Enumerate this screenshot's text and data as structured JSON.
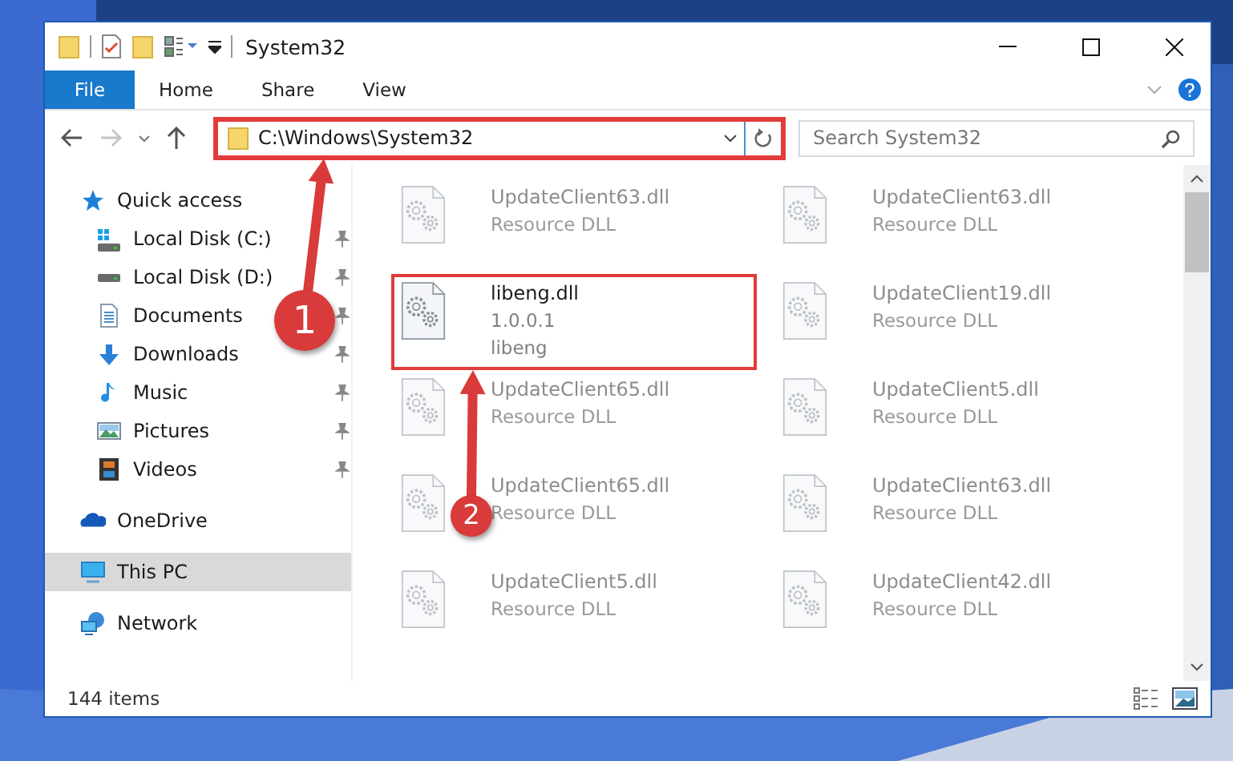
{
  "window": {
    "title": "System32"
  },
  "ribbon_tabs": [
    {
      "label": "File",
      "kind": "file"
    },
    {
      "label": "Home",
      "kind": "tab"
    },
    {
      "label": "Share",
      "kind": "tab"
    },
    {
      "label": "View",
      "kind": "tab"
    }
  ],
  "address_bar": {
    "path": "C:\\Windows\\System32",
    "highlighted": true
  },
  "search": {
    "placeholder": "Search System32"
  },
  "sidebar": {
    "items": [
      {
        "label": "Quick access",
        "kind": "star",
        "selected": false,
        "children": [
          {
            "label": "Local Disk (C:)",
            "kind": "system-drive",
            "pinned": true,
            "selected": false
          },
          {
            "label": "Local Disk (D:)",
            "kind": "drive",
            "pinned": true,
            "selected": false
          },
          {
            "label": "Documents",
            "kind": "documents",
            "pinned": true,
            "selected": false
          },
          {
            "label": "Downloads",
            "kind": "downloads",
            "pinned": true,
            "selected": false
          },
          {
            "label": "Music",
            "kind": "music",
            "pinned": true,
            "selected": false
          },
          {
            "label": "Pictures",
            "kind": "pictures",
            "pinned": true,
            "selected": false
          },
          {
            "label": "Videos",
            "kind": "videos",
            "pinned": true,
            "selected": false
          }
        ]
      },
      {
        "label": "OneDrive",
        "kind": "cloud",
        "selected": false
      },
      {
        "label": "This PC",
        "kind": "computer",
        "selected": true
      },
      {
        "label": "Network",
        "kind": "network",
        "selected": false
      }
    ]
  },
  "files": [
    {
      "name": "UpdateClient63.dll",
      "lines": [
        "Resource DLL"
      ],
      "dimmed": true,
      "highlighted": false
    },
    {
      "name": "UpdateClient63.dll",
      "lines": [
        "Resource DLL"
      ],
      "dimmed": true,
      "highlighted": false
    },
    {
      "name": "libeng.dll",
      "lines": [
        "1.0.0.1",
        "libeng"
      ],
      "dimmed": false,
      "highlighted": true
    },
    {
      "name": "UpdateClient19.dll",
      "lines": [
        "Resource DLL"
      ],
      "dimmed": true,
      "highlighted": false
    },
    {
      "name": "UpdateClient65.dll",
      "lines": [
        "Resource DLL"
      ],
      "dimmed": true,
      "highlighted": false
    },
    {
      "name": "UpdateClient5.dll",
      "lines": [
        "Resource DLL"
      ],
      "dimmed": true,
      "highlighted": false
    },
    {
      "name": "UpdateClient65.dll",
      "lines": [
        "Resource DLL"
      ],
      "dimmed": true,
      "highlighted": false
    },
    {
      "name": "UpdateClient63.dll",
      "lines": [
        "Resource DLL"
      ],
      "dimmed": true,
      "highlighted": false
    },
    {
      "name": "UpdateClient5.dll",
      "lines": [
        "Resource DLL"
      ],
      "dimmed": true,
      "highlighted": false
    },
    {
      "name": "UpdateClient42.dll",
      "lines": [
        "Resource DLL"
      ],
      "dimmed": true,
      "highlighted": false
    }
  ],
  "status_bar": {
    "count": "144 items"
  },
  "callouts": [
    {
      "number": "1"
    },
    {
      "number": "2"
    }
  ]
}
